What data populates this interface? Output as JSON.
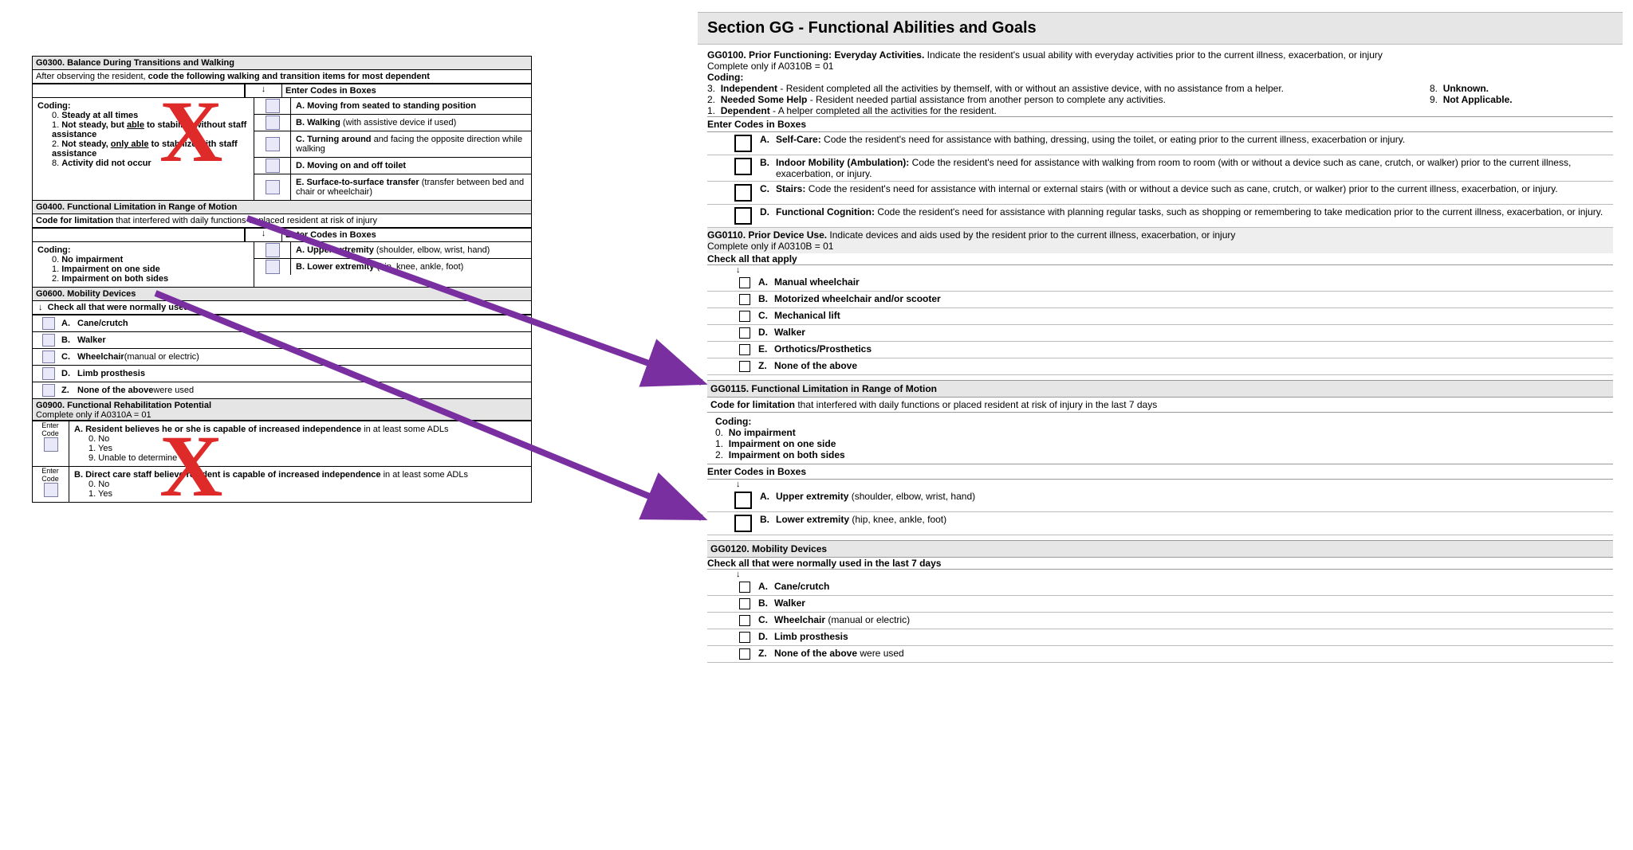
{
  "left": {
    "g0300": {
      "title": "G0300.  Balance During Transitions and Walking",
      "instr_pre": "After observing the resident, ",
      "instr_bold": "code the following walking and transition items for most dependent",
      "codesHdr": "Enter Codes in Boxes",
      "codingLabel": "Coding:",
      "c0": "Steady at all times",
      "c1_pre": "Not steady, but ",
      "c1_u": "able",
      "c1_post": " to stabilize without staff assistance",
      "c2_pre": "Not steady, ",
      "c2_u": "only able",
      "c2_post": " to stabilize with staff assistance",
      "c8": "Activity did not occur",
      "A_l": "A.",
      "A_b": "Moving from seated to standing position",
      "B_l": "B.",
      "B_b": "Walking",
      "B_t": " (with assistive device if used)",
      "C_l": "C.",
      "C_b": "Turning around",
      "C_t": " and facing the opposite direction while walking",
      "D_l": "D.",
      "D_b": "Moving on and off toilet",
      "E_l": "E.",
      "E_b": "Surface-to-surface transfer",
      "E_t": " (transfer between bed and chair or wheelchair)"
    },
    "g0400": {
      "title": "G0400.  Functional Limitation in Range of Motion",
      "instr_b": "Code for limitation",
      "instr_t": " that interfered with daily functions or placed resident at risk of injury",
      "codingLabel": "Coding:",
      "c0": "No impairment",
      "c1": "Impairment on one side",
      "c2": "Impairment on both sides",
      "codesHdr": "Enter Codes in Boxes",
      "A_l": "A.",
      "A_b": "Upper extremity",
      "A_t": " (shoulder, elbow, wrist, hand)",
      "B_l": "B.",
      "B_b": "Lower extremity",
      "B_t": " (hip, knee, ankle, foot)"
    },
    "g0600": {
      "title": "G0600.  Mobility Devices",
      "instr": "Check all that were normally used",
      "A_l": "A.",
      "A": "Cane/crutch",
      "B_l": "B.",
      "B": "Walker",
      "C_l": "C.",
      "C_b": "Wheelchair",
      "C_t": " (manual or electric)",
      "D_l": "D.",
      "D": "Limb prosthesis",
      "Z_l": "Z.",
      "Z_b": "None of the above",
      "Z_t": " were used"
    },
    "g0900": {
      "title": "G0900.  Functional Rehabilitation Potential",
      "complete": "Complete only if A0310A = 01",
      "enter": "Enter Code",
      "A_l": "A.",
      "A_b": "Resident believes he or she is capable of increased independence",
      "A_t": " in at least some ADLs",
      "a0": "0.  No",
      "a1": "1.  Yes",
      "a9": "9.  Unable to determine",
      "B_l": "B.",
      "B_b": "Direct care staff believe resident is capable of increased independence",
      "B_t": " in at least some ADLs",
      "b0": "0.  No",
      "b1": "1.  Yes"
    }
  },
  "right": {
    "section_title": "Section GG - Functional Abilities and Goals",
    "g0100": {
      "title": "GG0100.  Prior Functioning: Everyday Activities.",
      "desc": " Indicate the resident's usual ability with everyday activities prior to the current illness, exacerbation, or injury",
      "complete": "Complete only if A0310B = 01",
      "codingLabel": "Coding:",
      "c3b": "Independent",
      "c3t": " - Resident completed all the activities by themself, with or without an assistive device, with no assistance from a helper.",
      "c2b": "Needed Some Help",
      "c2t": " - Resident needed partial assistance from another person to complete any activities.",
      "c1b": "Dependent",
      "c1t": " - A helper completed all the activities for the resident.",
      "c8b": "Unknown.",
      "c9b": "Not Applicable.",
      "enter": "Enter Codes in Boxes",
      "A_l": "A.",
      "A_b": "Self-Care:",
      "A_t": " Code the resident's need for assistance with bathing, dressing, using the toilet, or eating prior to the current illness, exacerbation or injury.",
      "B_l": "B.",
      "B_b": "Indoor Mobility (Ambulation):",
      "B_t": " Code the resident's need for assistance with walking from room to room (with or without a device such as cane, crutch, or walker) prior to the current illness, exacerbation, or injury.",
      "C_l": "C.",
      "C_b": "Stairs:",
      "C_t": " Code the resident's need for assistance with internal or external stairs (with or without a device such as cane, crutch, or walker) prior to the current illness, exacerbation, or injury.",
      "D_l": "D.",
      "D_b": "Functional Cognition:",
      "D_t": " Code the resident's need for assistance with planning regular tasks, such as shopping or remembering to take medication prior to the current illness, exacerbation, or injury."
    },
    "g0110": {
      "title": "GG0110.  Prior Device Use.",
      "desc": " Indicate devices and aids used by the resident prior to the current illness, exacerbation, or injury",
      "complete": "Complete only if A0310B = 01",
      "check": "Check all that apply",
      "A_l": "A.",
      "A": "Manual wheelchair",
      "B_l": "B.",
      "B": "Motorized wheelchair and/or scooter",
      "C_l": "C.",
      "C": "Mechanical lift",
      "D_l": "D.",
      "D": "Walker",
      "E_l": "E.",
      "E": "Orthotics/Prosthetics",
      "Z_l": "Z.",
      "Z": "None of the above"
    },
    "g0115": {
      "title": "GG0115.  Functional Limitation in Range of Motion",
      "instr_b": "Code for limitation",
      "instr_t": " that interfered with daily functions or placed resident at risk of injury in the last 7 days",
      "codingLabel": "Coding:",
      "c0": "No impairment",
      "c1": "Impairment on one side",
      "c2": "Impairment on both sides",
      "enter": "Enter Codes in Boxes",
      "A_l": "A.",
      "A_b": "Upper extremity",
      "A_t": " (shoulder, elbow, wrist, hand)",
      "B_l": "B.",
      "B_b": "Lower extremity",
      "B_t": " (hip, knee, ankle, foot)"
    },
    "g0120": {
      "title": "GG0120.  Mobility Devices",
      "check": "Check all that were normally used in the last 7 days",
      "A_l": "A.",
      "A": "Cane/crutch",
      "B_l": "B.",
      "B": "Walker",
      "C_l": "C.",
      "C_b": "Wheelchair",
      "C_t": " (manual or electric)",
      "D_l": "D.",
      "D": "Limb prosthesis",
      "Z_l": "Z.",
      "Z_b": "None of the above",
      "Z_t": " were used"
    }
  }
}
